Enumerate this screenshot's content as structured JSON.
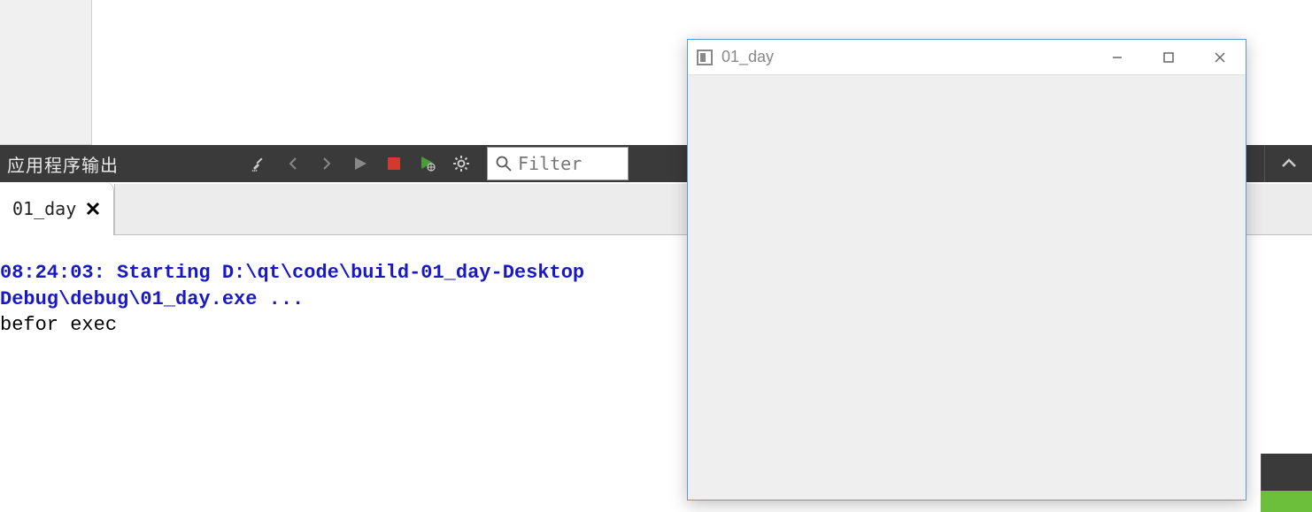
{
  "toolbar": {
    "title": "应用程序输出",
    "filter_placeholder": "Filter",
    "icons": {
      "clear": "clear-icon",
      "prev": "chevron-left-icon",
      "next": "chevron-right-icon",
      "run": "play-icon",
      "stop": "stop-icon",
      "debug": "debug-run-icon",
      "settings": "gear-icon",
      "collapse": "chevron-up-icon"
    }
  },
  "tabs": [
    {
      "label": "01_day"
    }
  ],
  "output": {
    "line1": "08:24:03: Starting D:\\qt\\code\\build-01_day-Desktop",
    "line2": "Debug\\debug\\01_day.exe ...",
    "line3": "befor exec"
  },
  "app_window": {
    "title": "01_day"
  },
  "colors": {
    "toolbar_bg": "#3a3a3a",
    "stop_red": "#d03b2e",
    "run_green": "#6bbf3b",
    "link_blue": "#1818c7"
  }
}
